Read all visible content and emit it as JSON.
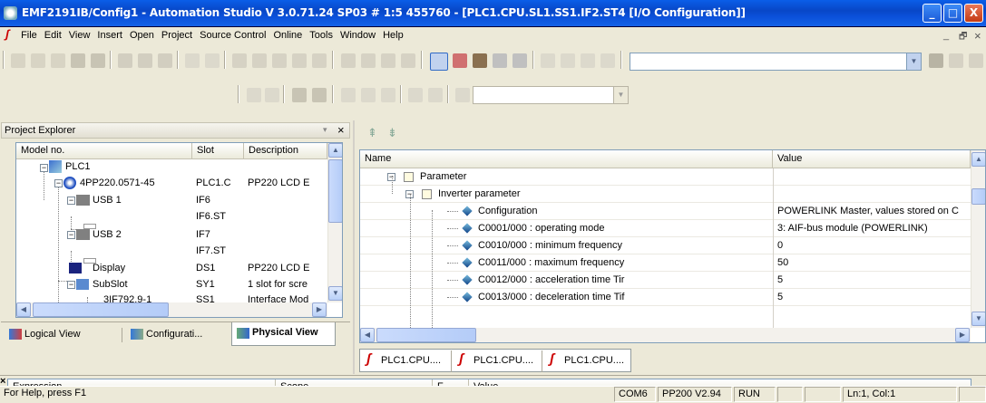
{
  "window": {
    "title": "EMF2191IB/Config1 - Automation Studio V 3.0.71.24 SP03 # 1:5 455760 - [PLC1.CPU.SL1.SS1.IF2.ST4 [I/O Configuration]]",
    "minimize": "_",
    "maximize": "□",
    "close": "X"
  },
  "menu": {
    "items": [
      "File",
      "Edit",
      "View",
      "Insert",
      "Open",
      "Project",
      "Source Control",
      "Online",
      "Tools",
      "Window",
      "Help"
    ],
    "mdi_min": "_",
    "mdi_restore": "🗗",
    "mdi_close": "×"
  },
  "project_explorer": {
    "title": "Project Explorer",
    "pin": "▾",
    "close": "×",
    "columns": [
      "Model no.",
      "Slot",
      "Description"
    ],
    "rows": [
      {
        "model": "PLC1",
        "slot": "",
        "desc": ""
      },
      {
        "model": "4PP220.0571-45",
        "slot": "PLC1.C",
        "desc": "PP220 LCD E"
      },
      {
        "model": "USB 1",
        "slot": "IF6",
        "desc": ""
      },
      {
        "model": "",
        "slot": "IF6.ST",
        "desc": ""
      },
      {
        "model": "USB 2",
        "slot": "IF7",
        "desc": ""
      },
      {
        "model": "",
        "slot": "IF7.ST",
        "desc": ""
      },
      {
        "model": "Display",
        "slot": "DS1",
        "desc": "PP220 LCD E"
      },
      {
        "model": "SubSlot",
        "slot": "SY1",
        "desc": "1 slot for scre"
      },
      {
        "model": "3IF792.9-1",
        "slot": "SS1",
        "desc": "Interface Mod"
      }
    ],
    "tabs": [
      {
        "label": "Logical View"
      },
      {
        "label": "Configurati..."
      },
      {
        "label": "Physical View"
      }
    ]
  },
  "io_config": {
    "columns": [
      "Name",
      "Value"
    ],
    "rows": [
      {
        "level": 0,
        "name": "Parameter",
        "value": "",
        "kind": "folder"
      },
      {
        "level": 1,
        "name": "Inverter parameter",
        "value": "",
        "kind": "folder"
      },
      {
        "level": 2,
        "name": "Configuration",
        "value": "POWERLINK Master, values stored on C",
        "kind": "param"
      },
      {
        "level": 2,
        "name": "C0001/000 : operating mode",
        "value": "3: AIF-bus module (POWERLINK)",
        "kind": "param"
      },
      {
        "level": 2,
        "name": "C0010/000 : minimum frequency",
        "value": "0",
        "kind": "param"
      },
      {
        "level": 2,
        "name": "C0011/000 : maximum frequency",
        "value": "50",
        "kind": "param"
      },
      {
        "level": 2,
        "name": "C0012/000 : acceleration time Tir",
        "value": "5",
        "kind": "param"
      },
      {
        "level": 2,
        "name": "C0013/000 : deceleration time Tif",
        "value": "5",
        "kind": "param"
      }
    ],
    "doc_tabs": [
      "PLC1.CPU....",
      "PLC1.CPU....",
      "PLC1.CPU...."
    ]
  },
  "watch": {
    "columns": [
      "Expression",
      "Scope",
      "F",
      "Value"
    ]
  },
  "statusbar": {
    "help": "For Help, press F1",
    "port": "COM6",
    "target": "PP200  V2.94",
    "mode": "RUN",
    "position": "Ln:1, Col:1"
  },
  "colors": {
    "title_blue": "#0a5ee8",
    "chrome": "#ece9d8",
    "selection_border": "#7f9db9"
  }
}
